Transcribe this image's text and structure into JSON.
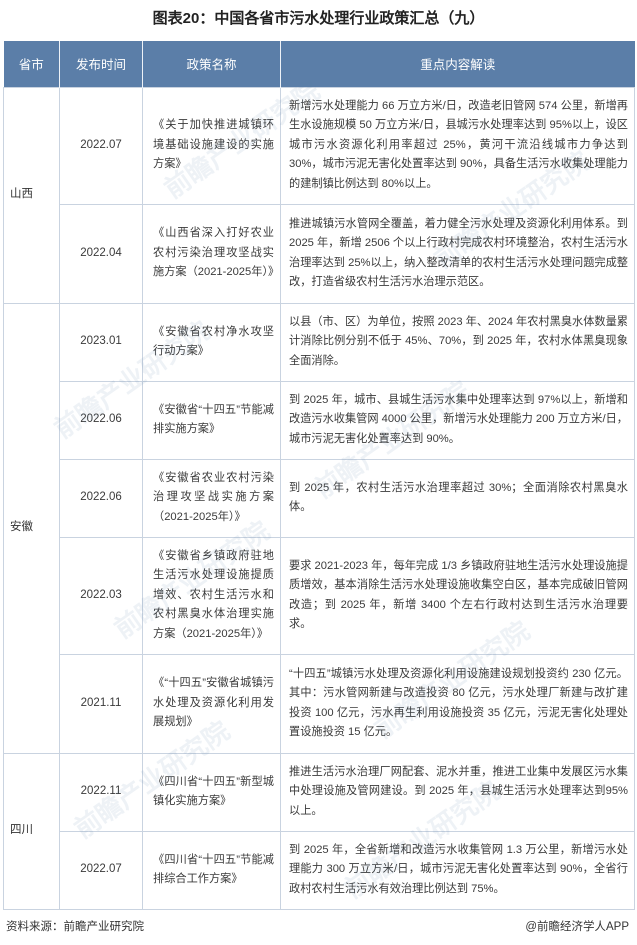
{
  "title": "图表20：中国各省市污水处理行业政策汇总（九）",
  "headers": [
    "省市",
    "发布时间",
    "政策名称",
    "重点内容解读"
  ],
  "rows": [
    {
      "province": "山西",
      "span": 2,
      "date": "2022.07",
      "name": "《关于加快推进城镇环境基础设施建设的实施方案》",
      "detail": "新增污水处理能力 66 万立方米/日，改造老旧管网 574 公里，新增再生水设施规模 50 万立方米/日，县城污水处理率达到 95%以上，设区城市污水资源化利用率超过 25%，黄河干流沿线城市力争达到 30%，城市污泥无害化处置率达到 90%，具备生活污水收集处理能力的建制镇比例达到 80%以上。"
    },
    {
      "date": "2022.04",
      "name": "《山西省深入打好农业农村污染治理攻坚战实施方案（2021-2025年）》",
      "detail": "推进城镇污水管网全覆盖，着力健全污水处理及资源化利用体系。到 2025 年，新增 2506 个以上行政村完成农村环境整治，农村生活污水治理率达到 25%以上，纳入整改清单的农村生活污水处理问题完成整改，打造省级农村生活污水治理示范区。"
    },
    {
      "province": "安徽",
      "span": 5,
      "date": "2023.01",
      "name": "《安徽省农村净水攻坚行动方案》",
      "detail": "以县（市、区）为单位，按照 2023 年、2024 年农村黑臭水体数量累计消除比例分别不低于 45%、70%，到 2025 年，农村水体黑臭现象全面消除。"
    },
    {
      "date": "2022.06",
      "name": "《安徽省“十四五”节能减排实施方案》",
      "detail": "到 2025 年，城市、县城生活污水集中处理率达到 97%以上，新增和改造污水收集管网 4000 公里，新增污水处理能力 200 万立方米/日，城市污泥无害化处置率达到 90%。"
    },
    {
      "date": "2022.06",
      "name": "《安徽省农业农村污染治理攻坚战实施方案（2021-2025年）》",
      "detail": "到 2025 年，农村生活污水治理率超过 30%；全面消除农村黑臭水体。"
    },
    {
      "date": "2022.03",
      "name": "《安徽省乡镇政府驻地生活污水处理设施提质增效、农村生活污水和农村黑臭水体治理实施方案（2021-2025年）》",
      "detail": "要求 2021-2023 年，每年完成 1/3 乡镇政府驻地生活污水处理设施提质增效，基本消除生活污水处理设施收集空白区，基本完成破旧管网改造；到 2025 年，新增 3400 个左右行政村达到生活污水治理要求。"
    },
    {
      "date": "2021.11",
      "name": "《“十四五”安徽省城镇污水处理及资源化利用发展规划》",
      "detail": "“十四五”城镇污水处理及资源化利用设施建设规划投资约 230 亿元。其中：污水管网新建与改造投资 80 亿元，污水处理厂新建与改扩建投资 100 亿元，污水再生利用设施投资 35 亿元，污泥无害化处理处置设施投资 15 亿元。"
    },
    {
      "province": "四川",
      "span": 2,
      "date": "2022.11",
      "name": "《四川省“十四五”新型城镇化实施方案》",
      "detail": "推进生活污水治理厂网配套、泥水并重，推进工业集中发展区污水集中处理设施及管网建设。到 2025 年，县城生活污水处理率达到95%以上。"
    },
    {
      "date": "2022.07",
      "name": "《四川省“十四五”节能减排综合工作方案》",
      "detail": "到 2025 年，全省新增和改造污水收集管网 1.3 万公里，新增污水处理能力 300 万立方米/日，城市污泥无害化处置率达到 90%，全省行政村农村生活污水有效治理比例达到 75%。"
    }
  ],
  "footer": {
    "source": "资料来源：前瞻产业研究院",
    "brand": "@前瞻经济学人APP"
  },
  "watermark": "前瞻产业研究院"
}
